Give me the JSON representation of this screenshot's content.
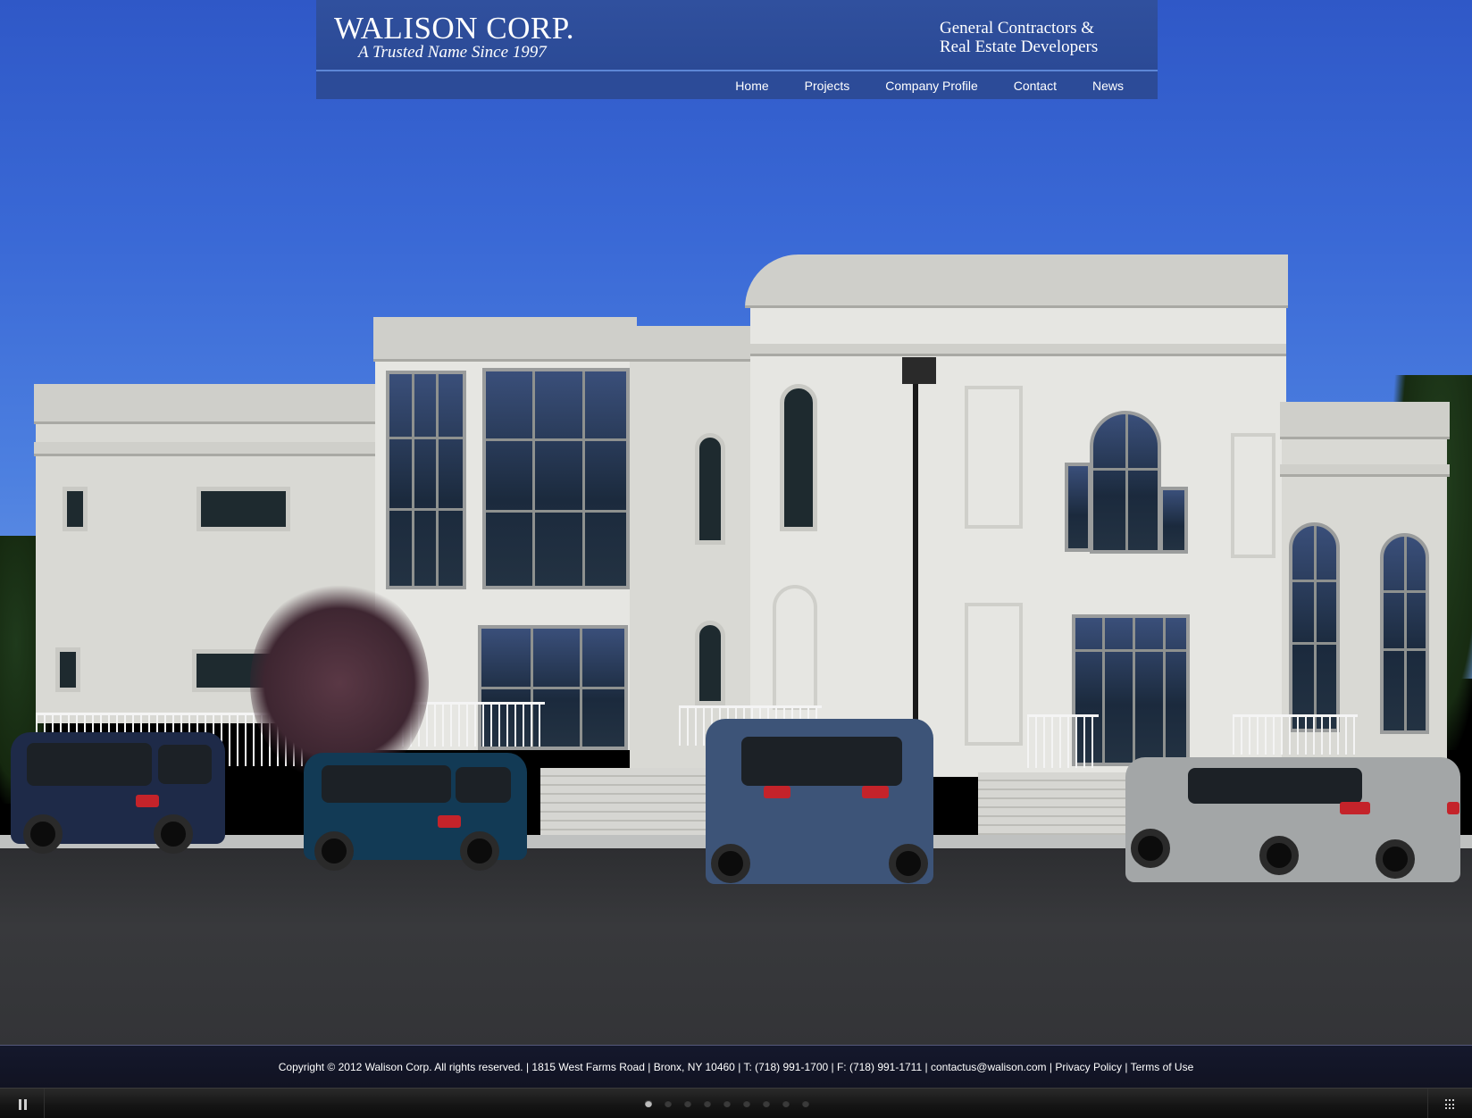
{
  "header": {
    "logo_title": "WALISON CORP.",
    "logo_tagline": "A Trusted Name Since 1997",
    "blurb_line1": "General Contractors &",
    "blurb_line2": "Real Estate Developers",
    "background_color": "#2c4b98"
  },
  "nav": {
    "items": [
      {
        "label": "Home"
      },
      {
        "label": "Projects"
      },
      {
        "label": "Company Profile"
      },
      {
        "label": "Contact"
      },
      {
        "label": "News"
      }
    ]
  },
  "hero": {
    "description_visible": false
  },
  "footer": {
    "copyright": "Copyright © 2012 Walison Corp. All rights reserved.",
    "address": "1815 West Farms Road",
    "city": "Bronx, NY 10460",
    "phone": "T: (718) 991-1700",
    "fax": "F: (718) 991-1711",
    "email": "contactus@walison.com",
    "privacy_label": "Privacy Policy",
    "terms_label": "Terms of Use",
    "separator": "|"
  },
  "slideshow": {
    "pause_icon": "pause-icon",
    "thumbnails_icon": "grid-icon",
    "slide_count": 9,
    "active_slide": 1
  }
}
